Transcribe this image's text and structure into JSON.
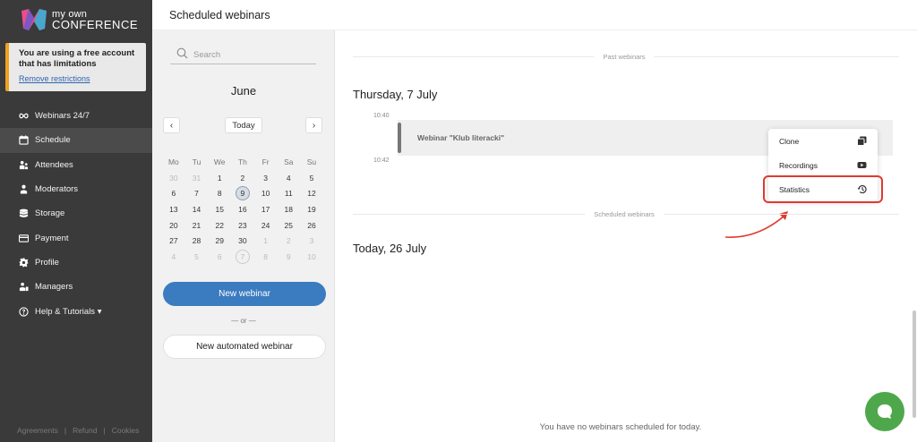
{
  "app": {
    "logo_line1": "my own",
    "logo_line2": "CONFERENCE"
  },
  "notice": {
    "text": "You are using a free account that has limitations",
    "link": "Remove restrictions"
  },
  "sidebar": {
    "items": [
      {
        "label": "Webinars 24/7",
        "icon": "infinity-icon"
      },
      {
        "label": "Schedule",
        "icon": "calendar-icon",
        "active": true
      },
      {
        "label": "Attendees",
        "icon": "attendees-icon"
      },
      {
        "label": "Moderators",
        "icon": "moderator-icon"
      },
      {
        "label": "Storage",
        "icon": "storage-icon"
      },
      {
        "label": "Payment",
        "icon": "payment-icon"
      },
      {
        "label": "Profile",
        "icon": "gear-icon"
      },
      {
        "label": "Managers",
        "icon": "managers-icon"
      },
      {
        "label": "Help & Tutorials ▾",
        "icon": "help-icon"
      }
    ],
    "footer": [
      "Agreements",
      "Refund",
      "Cookies"
    ]
  },
  "header": {
    "title": "Scheduled webinars"
  },
  "calendar": {
    "search_placeholder": "Search",
    "month": "June",
    "today_label": "Today",
    "prev": "‹",
    "next": "›",
    "weekdays": [
      "Mo",
      "Tu",
      "We",
      "Th",
      "Fr",
      "Sa",
      "Su"
    ],
    "weeks": [
      [
        "30",
        "31",
        "1",
        "2",
        "3",
        "4",
        "5"
      ],
      [
        "6",
        "7",
        "8",
        "9",
        "10",
        "11",
        "12"
      ],
      [
        "13",
        "14",
        "15",
        "16",
        "17",
        "18",
        "19"
      ],
      [
        "20",
        "21",
        "22",
        "23",
        "24",
        "25",
        "26"
      ],
      [
        "27",
        "28",
        "29",
        "30",
        "1",
        "2",
        "3"
      ],
      [
        "4",
        "5",
        "6",
        "7",
        "8",
        "9",
        "10"
      ]
    ],
    "new_webinar": "New webinar",
    "or": "— or —",
    "new_automated": "New automated webinar"
  },
  "main": {
    "past_label": "Past webinars",
    "past_date": "Thursday, 7 July",
    "time_start": "10:40",
    "time_end": "10:42",
    "webinar_title": "Webinar \"Klub literacki\"",
    "menu": [
      {
        "label": "Clone",
        "icon": "clone-icon"
      },
      {
        "label": "Recordings",
        "icon": "youtube-icon"
      },
      {
        "label": "Statistics",
        "icon": "history-icon"
      }
    ],
    "scheduled_label": "Scheduled webinars",
    "today_date": "Today, 26 July",
    "empty_message": "You have no webinars scheduled for today."
  },
  "colors": {
    "sidebar_bg": "#3a3a3a",
    "accent_blue": "#3b7bbf",
    "highlight_red": "#e03a2f",
    "chat_green": "#4ea84b"
  }
}
